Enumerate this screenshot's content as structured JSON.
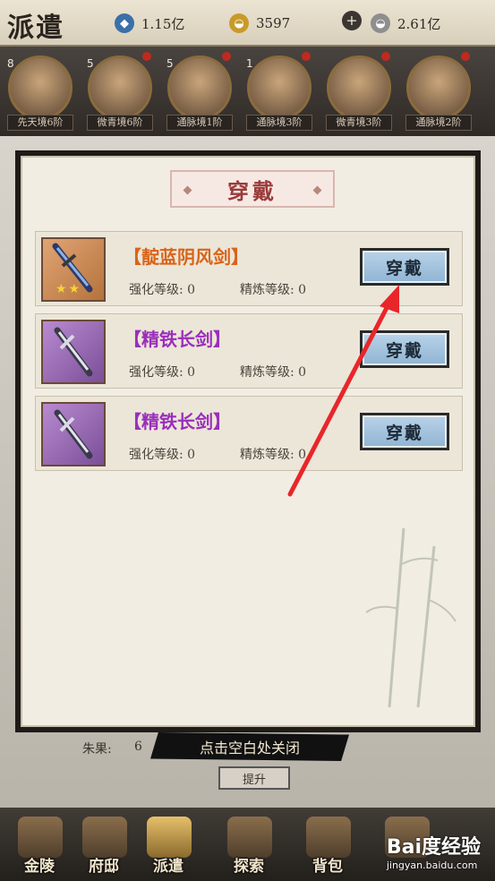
{
  "header": {
    "title": "派遣",
    "resources": [
      {
        "icon": "gem-icon",
        "value": "1.15亿",
        "color": "#3b6fa8"
      },
      {
        "icon": "gold-ingot-icon",
        "value": "3597",
        "color": "#c99a2a"
      },
      {
        "icon": "silver-ingot-icon",
        "value": "2.61亿",
        "color": "#8e8e8e"
      }
    ],
    "plus": "+"
  },
  "heroes": [
    {
      "level": "8",
      "tag": "先天境6阶"
    },
    {
      "level": "5",
      "tag": "微青境6阶"
    },
    {
      "level": "5",
      "tag": "通脉境1阶"
    },
    {
      "level": "1",
      "tag": "通脉境3阶"
    },
    {
      "level": "",
      "tag": "微青境3阶"
    },
    {
      "level": "",
      "tag": "通脉境2阶"
    }
  ],
  "dialog": {
    "title": "穿戴",
    "items": [
      {
        "name": "【靛蓝阴风剑】",
        "rarity": "orange",
        "stars": "★★",
        "strengthen": "强化等级: 0",
        "refine": "精炼等级: 0",
        "button": "穿戴"
      },
      {
        "name": "【精铁长剑】",
        "rarity": "purple",
        "stars": "",
        "strengthen": "强化等级: 0",
        "refine": "精炼等级: 0",
        "button": "穿戴"
      },
      {
        "name": "【精铁长剑】",
        "rarity": "purple",
        "stars": "",
        "strengthen": "强化等级: 0",
        "refine": "精炼等级: 0",
        "button": "穿戴"
      }
    ]
  },
  "close_hint": "点击空白处关闭",
  "fruit_label": "朱果:",
  "fruit_value": "6",
  "upgrade_label": "提升",
  "nav": [
    {
      "label": "金陵",
      "active": false
    },
    {
      "label": "府邸",
      "active": false
    },
    {
      "label": "派遣",
      "active": true
    },
    {
      "label": "探索",
      "active": false
    },
    {
      "label": "背包",
      "active": false
    },
    {
      "label": "",
      "active": false
    }
  ],
  "watermark": {
    "main": "Bai度经验",
    "sub": "jingyan.baidu.com"
  },
  "colors": {
    "annotation_arrow": "#e8262a",
    "equip_button": "#9ec0dd"
  }
}
